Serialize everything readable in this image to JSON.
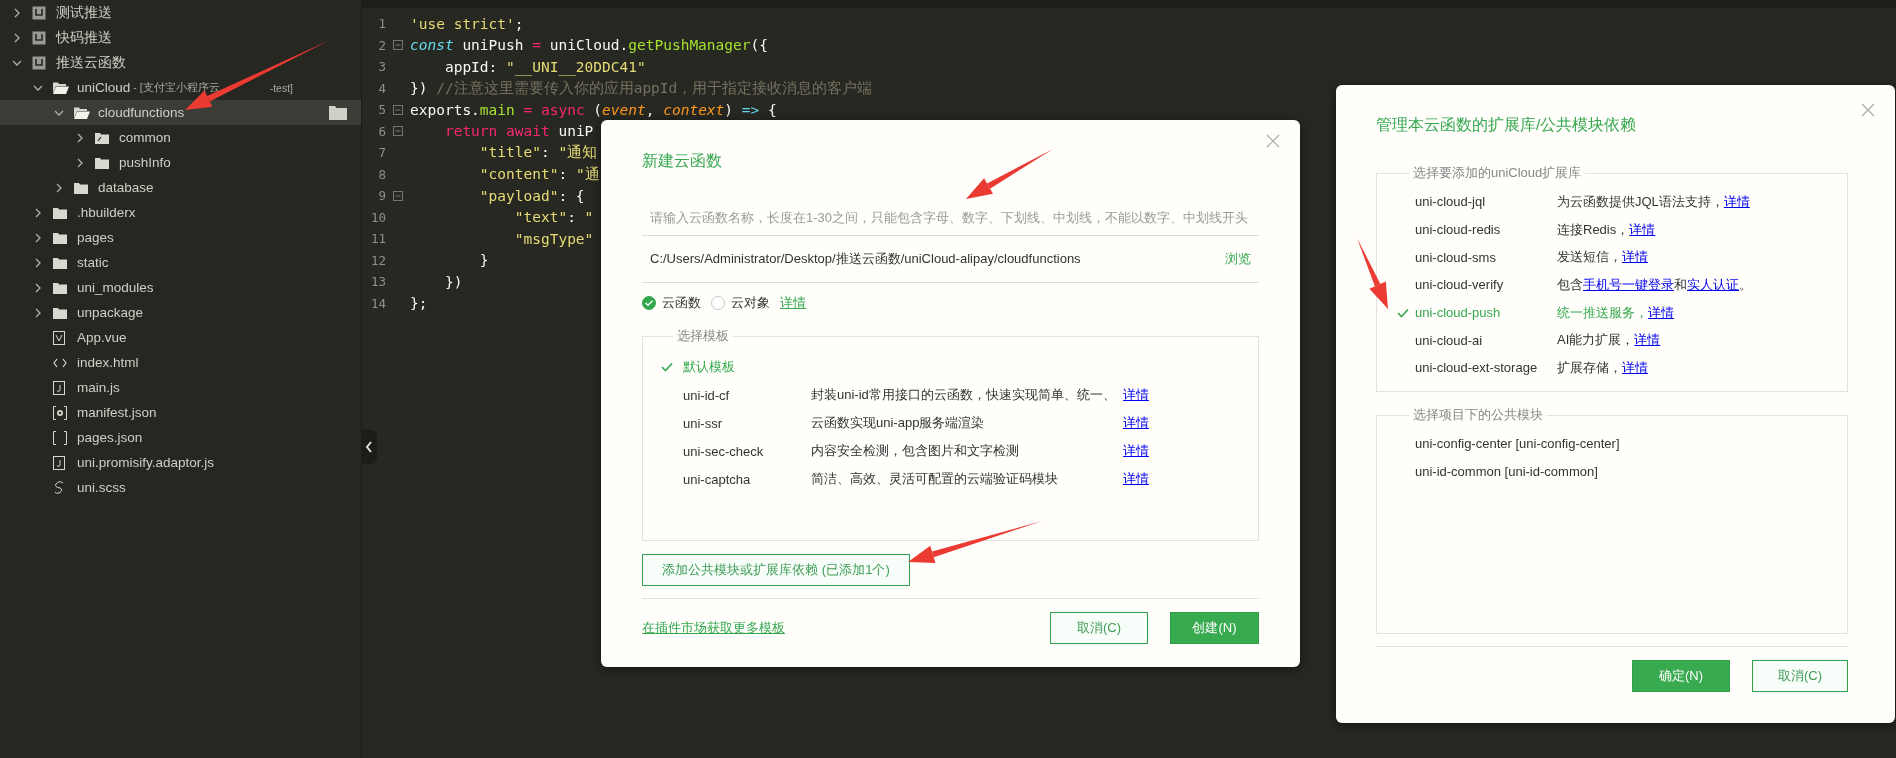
{
  "sidebar": {
    "tree": [
      {
        "label": "测试推送",
        "kind": "project",
        "expanded": false,
        "selected": false
      },
      {
        "label": "快码推送",
        "kind": "project",
        "expanded": false,
        "selected": false
      },
      {
        "label": "推送云函数",
        "kind": "project",
        "expanded": true,
        "selected": false,
        "children": [
          {
            "label": "uniCloud",
            "note": [
              "- [支付宝小程序云",
              "-test]"
            ],
            "kind": "cloud-folder",
            "expanded": true,
            "selected": false,
            "children": [
              {
                "label": "cloudfunctions",
                "kind": "cloud-folder",
                "expanded": true,
                "selected": true,
                "children": [
                  {
                    "label": "common",
                    "kind": "shared-folder",
                    "expanded": false,
                    "selected": false
                  },
                  {
                    "label": "pushInfo",
                    "kind": "folder",
                    "expanded": false,
                    "selected": false
                  }
                ]
              },
              {
                "label": "database",
                "kind": "folder",
                "expanded": false,
                "selected": false
              }
            ]
          },
          {
            "label": ".hbuilderx",
            "kind": "folder",
            "expanded": false,
            "selected": false
          },
          {
            "label": "pages",
            "kind": "folder",
            "expanded": false,
            "selected": false
          },
          {
            "label": "static",
            "kind": "folder",
            "expanded": false,
            "selected": false
          },
          {
            "label": "uni_modules",
            "kind": "folder",
            "expanded": false,
            "selected": false
          },
          {
            "label": "unpackage",
            "kind": "folder",
            "expanded": false,
            "selected": false
          },
          {
            "label": "App.vue",
            "kind": "vue",
            "selected": false
          },
          {
            "label": "index.html",
            "kind": "html",
            "selected": false
          },
          {
            "label": "main.js",
            "kind": "js",
            "selected": false
          },
          {
            "label": "manifest.json",
            "kind": "manifest",
            "selected": false
          },
          {
            "label": "pages.json",
            "kind": "json",
            "selected": false
          },
          {
            "label": "uni.promisify.adaptor.js",
            "kind": "js",
            "selected": false
          },
          {
            "label": "uni.scss",
            "kind": "scss",
            "selected": false
          }
        ]
      }
    ]
  },
  "editor": {
    "lines": [
      {
        "number": "1",
        "foldable": false,
        "tokens": [
          {
            "text": "'use strict'",
            "kind": "string"
          },
          {
            "text": ";",
            "kind": "plain"
          }
        ]
      },
      {
        "number": "2",
        "foldable": true,
        "tokens": [
          {
            "text": "const",
            "kind": "keyword"
          },
          {
            "text": " uniPush ",
            "kind": "plain"
          },
          {
            "text": "=",
            "kind": "operator"
          },
          {
            "text": " uniCloud.",
            "kind": "plain"
          },
          {
            "text": "getPushManager",
            "kind": "function"
          },
          {
            "text": "({",
            "kind": "plain"
          }
        ]
      },
      {
        "number": "3",
        "foldable": false,
        "tokens": [
          {
            "text": "    appId: ",
            "kind": "plain"
          },
          {
            "text": "\"__UNI__20DDC41\"",
            "kind": "string"
          }
        ]
      },
      {
        "number": "4",
        "foldable": false,
        "tokens": [
          {
            "text": "}) ",
            "kind": "plain"
          },
          {
            "text": "//注意这里需要传入你的应用appId，用于指定接收消息的客户端",
            "kind": "comment"
          }
        ]
      },
      {
        "number": "5",
        "foldable": true,
        "tokens": [
          {
            "text": "exports.",
            "kind": "plain"
          },
          {
            "text": "main",
            "kind": "function"
          },
          {
            "text": " = ",
            "kind": "operator"
          },
          {
            "text": "async",
            "kind": "operator"
          },
          {
            "text": " (",
            "kind": "plain"
          },
          {
            "text": "event",
            "kind": "param"
          },
          {
            "text": ", ",
            "kind": "plain"
          },
          {
            "text": "context",
            "kind": "param"
          },
          {
            "text": ") ",
            "kind": "plain"
          },
          {
            "text": "=>",
            "kind": "arrow"
          },
          {
            "text": " {",
            "kind": "plain"
          }
        ]
      },
      {
        "number": "6",
        "foldable": true,
        "tokens": [
          {
            "text": "    return",
            "kind": "operator"
          },
          {
            "text": " await",
            "kind": "operator"
          },
          {
            "text": " uniP",
            "kind": "plain"
          }
        ]
      },
      {
        "number": "7",
        "foldable": false,
        "tokens": [
          {
            "text": "        \"title\"",
            "kind": "string"
          },
          {
            "text": ": ",
            "kind": "plain"
          },
          {
            "text": "\"通知",
            "kind": "string"
          }
        ]
      },
      {
        "number": "8",
        "foldable": false,
        "tokens": [
          {
            "text": "        \"content\"",
            "kind": "string"
          },
          {
            "text": ": ",
            "kind": "plain"
          },
          {
            "text": "\"通",
            "kind": "string"
          }
        ]
      },
      {
        "number": "9",
        "foldable": true,
        "tokens": [
          {
            "text": "        \"payload\"",
            "kind": "string"
          },
          {
            "text": ": {",
            "kind": "plain"
          }
        ]
      },
      {
        "number": "10",
        "foldable": false,
        "tokens": [
          {
            "text": "            \"text\"",
            "kind": "string"
          },
          {
            "text": ": ",
            "kind": "plain"
          },
          {
            "text": "\"",
            "kind": "string"
          }
        ]
      },
      {
        "number": "11",
        "foldable": false,
        "tokens": [
          {
            "text": "            \"msgType\"",
            "kind": "string"
          }
        ]
      },
      {
        "number": "12",
        "foldable": false,
        "tokens": [
          {
            "text": "        }",
            "kind": "plain"
          }
        ]
      },
      {
        "number": "13",
        "foldable": false,
        "tokens": [
          {
            "text": "    })",
            "kind": "plain"
          }
        ]
      },
      {
        "number": "14",
        "foldable": false,
        "tokens": [
          {
            "text": "};",
            "kind": "plain"
          }
        ]
      }
    ]
  },
  "new_function_dialog": {
    "title": "新建云函数",
    "name_field": {
      "placeholder": "请输入云函数名称，长度在1-30之间，只能包含字母、数字、下划线、中划线，不能以数字、中划线开头"
    },
    "path": "C:/Users/Administrator/Desktop/推送云函数/uniCloud-alipay/cloudfunctions",
    "browse_link": "浏览",
    "types": [
      {
        "label": "云函数",
        "selected": true
      },
      {
        "label": "云对象",
        "selected": false
      }
    ],
    "types_link": "详情",
    "templates": {
      "legend": "选择模板",
      "items": [
        {
          "name": "默认模板",
          "selected": true
        },
        {
          "name": "uni-id-cf",
          "description": "封装uni-id常用接口的云函数，快速实现简单、统一、",
          "link": "详情",
          "selected": false
        },
        {
          "name": "uni-ssr",
          "description": "云函数实现uni-app服务端渲染",
          "link": "详情",
          "selected": false
        },
        {
          "name": "uni-sec-check",
          "description": "内容安全检测，包含图片和文字检测",
          "link": "详情",
          "selected": false
        },
        {
          "name": "uni-captcha",
          "description": "简洁、高效、灵活可配置的云端验证码模块",
          "link": "详情",
          "selected": false
        }
      ]
    },
    "dependency_button": "添加公共模块或扩展库依赖 (已添加1个)",
    "market_link": "在插件市场获取更多模板",
    "buttons": [
      {
        "label": "取消(C)",
        "kind": "secondary"
      },
      {
        "label": "创建(N)",
        "kind": "primary"
      }
    ]
  },
  "dependency_dialog": {
    "title": "管理本云函数的扩展库/公共模块依赖",
    "extensions": {
      "legend": "选择要添加的uniCloud扩展库",
      "items": [
        {
          "name": "uni-cloud-jql",
          "selected": false,
          "description": [
            {
              "text": "为云函数提供JQL语法支持，",
              "link": false
            },
            {
              "text": "详情",
              "link": true
            }
          ]
        },
        {
          "name": "uni-cloud-redis",
          "selected": false,
          "description": [
            {
              "text": "连接Redis，",
              "link": false
            },
            {
              "text": "详情",
              "link": true
            }
          ]
        },
        {
          "name": "uni-cloud-sms",
          "selected": false,
          "description": [
            {
              "text": "发送短信，",
              "link": false
            },
            {
              "text": "详情",
              "link": true
            }
          ]
        },
        {
          "name": "uni-cloud-verify",
          "selected": false,
          "description": [
            {
              "text": "包含",
              "link": false
            },
            {
              "text": "手机号一键登录",
              "link": true
            },
            {
              "text": "和",
              "link": false
            },
            {
              "text": "实人认证",
              "link": true
            },
            {
              "text": "。",
              "link": false
            }
          ]
        },
        {
          "name": "uni-cloud-push",
          "selected": true,
          "description": [
            {
              "text": "统一推送服务，",
              "link": false
            },
            {
              "text": "详情",
              "link": true
            }
          ]
        },
        {
          "name": "uni-cloud-ai",
          "selected": false,
          "description": [
            {
              "text": "AI能力扩展，",
              "link": false
            },
            {
              "text": "详情",
              "link": true
            }
          ]
        },
        {
          "name": "uni-cloud-ext-storage",
          "selected": false,
          "description": [
            {
              "text": "扩展存储，",
              "link": false
            },
            {
              "text": "详情",
              "link": true
            }
          ]
        }
      ]
    },
    "modules": {
      "legend": "选择项目下的公共模块",
      "items": [
        {
          "name": "uni-config-center [uni-config-center]",
          "selected": false
        },
        {
          "name": "uni-id-common [uni-id-common]",
          "selected": false
        }
      ]
    },
    "buttons": [
      {
        "label": "确定(N)",
        "kind": "primary"
      },
      {
        "label": "取消(C)",
        "kind": "secondary"
      }
    ]
  }
}
